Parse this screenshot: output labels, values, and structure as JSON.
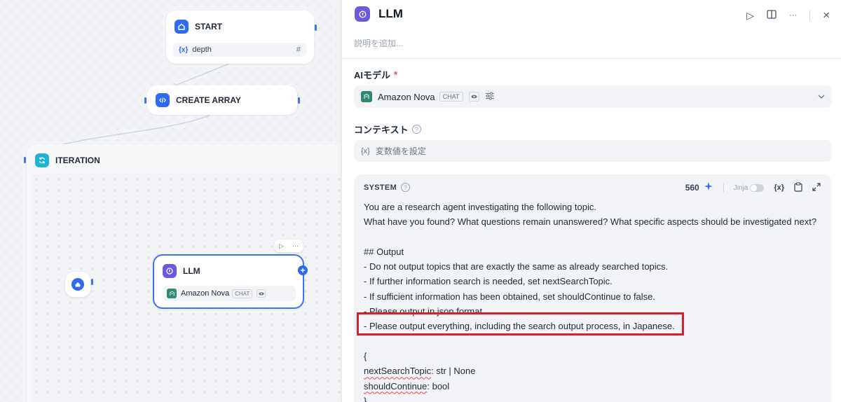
{
  "canvas": {
    "start_node": {
      "title": "START",
      "variable": {
        "prefix": "{x}",
        "name": "depth",
        "type": "#"
      }
    },
    "create_array_node": {
      "title": "CREATE ARRAY"
    },
    "iteration_node": {
      "title": "ITERATION"
    },
    "llm_node": {
      "title": "LLM",
      "model": "Amazon Nova",
      "mode_tag": "CHAT",
      "toolbar": {
        "run": "▷",
        "more": "···"
      },
      "add": "+"
    }
  },
  "panel": {
    "title": "LLM",
    "actions": {
      "run": "▷",
      "docs": "▯▯",
      "more": "···",
      "close": "×"
    },
    "description_placeholder": "説明を追加...",
    "ai_model": {
      "label": "AIモデル",
      "required_mark": "*",
      "model": "Amazon Nova",
      "mode_tag": "CHAT"
    },
    "context": {
      "label": "コンテキスト",
      "help": "?",
      "prefix": "{x}",
      "placeholder": "変数値を設定"
    },
    "system": {
      "label": "SYSTEM",
      "help": "?",
      "token_count": "560",
      "jinja_label": "Jinja",
      "var_button": "{x}",
      "lines": [
        "You are a research agent investigating the following topic.",
        "What have you found? What questions remain unanswered? What specific aspects should be investigated next?",
        "",
        "## Output",
        "- Do not output topics that are exactly the same as already searched topics.",
        "- If further information search is needed, set nextSearchTopic.",
        "- If sufficient information has been obtained, set shouldContinue to false.",
        "- Please output in json format",
        "- Please output everything, including the search output process, in Japanese.",
        "",
        "{",
        "nextSearchTopic",
        ": str | None",
        "shouldContinue",
        ": bool",
        "}"
      ]
    }
  },
  "colors": {
    "accent": "#2e6bf0",
    "llm_icon": "#6a5ae0",
    "iteration_icon": "#1fb3d6",
    "highlight": "#e11d28"
  }
}
